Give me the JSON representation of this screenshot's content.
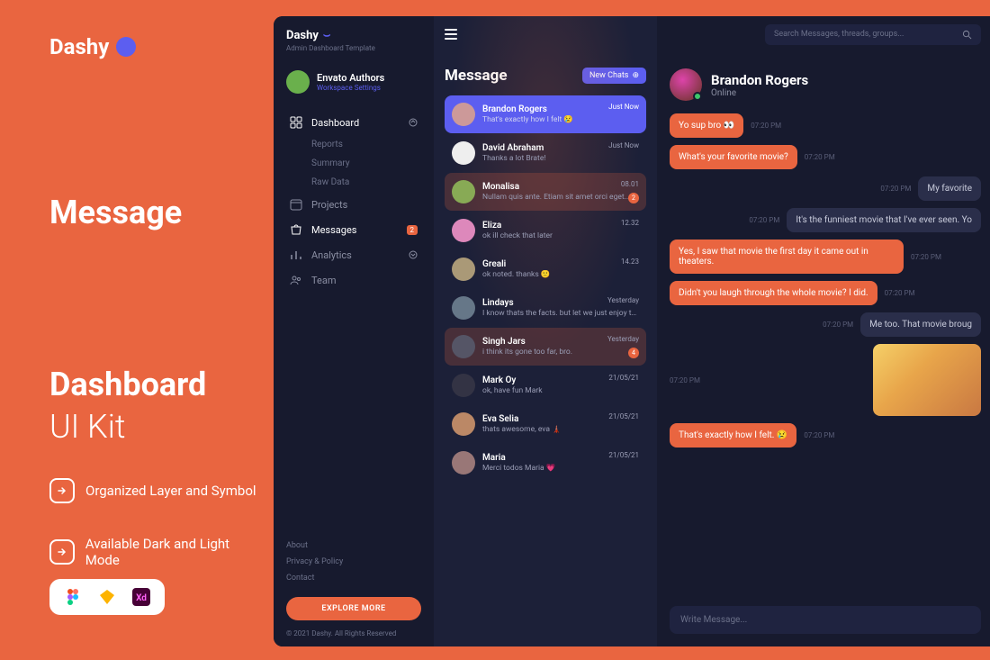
{
  "promo": {
    "brand": "Dashy",
    "title_l1": "Message",
    "title_l2": "Dashboard",
    "subtitle": "UI Kit",
    "feat1": "Organized Layer and Symbol",
    "feat2": "Available Dark and Light Mode"
  },
  "app": {
    "brand": "Dashy",
    "tagline": "Admin Dashboard Template",
    "workspace": {
      "name": "Envato Authors",
      "settings": "Workspace Settings"
    },
    "nav": {
      "dashboard": "Dashboard",
      "reports": "Reports",
      "summary": "Summary",
      "rawdata": "Raw Data",
      "projects": "Projects",
      "messages": "Messages",
      "messages_badge": "2",
      "analytics": "Analytics",
      "team": "Team"
    },
    "links": {
      "about": "About",
      "privacy": "Privacy & Policy",
      "contact": "Contact"
    },
    "cta": "EXPLORE MORE",
    "footer": "© 2021 Dashy. All Rights Reserved"
  },
  "search": {
    "placeholder": "Search Messages, threads, groups..."
  },
  "msglist": {
    "title": "Message",
    "new_label": "New Chats",
    "threads": [
      {
        "name": "Brandon Rogers",
        "preview": "That's exactly how I felt 😢",
        "time": "Just Now"
      },
      {
        "name": "David Abraham",
        "preview": "Thanks a lot Brate!",
        "time": "Just Now"
      },
      {
        "name": "Monalisa",
        "preview": "Nullam quis ante. Etiam sit amet orci eget...",
        "time": "08.01",
        "badge": "2"
      },
      {
        "name": "Eliza",
        "preview": "ok ill check that later",
        "time": "12.32"
      },
      {
        "name": "Greali",
        "preview": "ok noted. thanks 🙂",
        "time": "14.23"
      },
      {
        "name": "Lindays",
        "preview": "I know thats the facts. but let we just enjoy th...",
        "time": "Yesterday"
      },
      {
        "name": "Singh Jars",
        "preview": "i think its gone too far, bro.",
        "time": "Yesterday",
        "badge": "4"
      },
      {
        "name": "Mark Oy",
        "preview": "ok, have fun Mark",
        "time": "21/05/21"
      },
      {
        "name": "Eva Selia",
        "preview": "thats awesome, eva 🗼",
        "time": "21/05/21"
      },
      {
        "name": "Maria",
        "preview": "Merci todos Maria 💗",
        "time": "21/05/21"
      }
    ]
  },
  "chat": {
    "name": "Brandon Rogers",
    "status": "Online",
    "composer": "Write Message...",
    "m": [
      {
        "dir": "out",
        "text": "Yo sup bro 👀",
        "time": "07:20 PM"
      },
      {
        "dir": "out",
        "text": "What's your favorite movie?",
        "time": "07:20 PM"
      },
      {
        "dir": "in",
        "text": "My favorite",
        "time": "07:20 PM"
      },
      {
        "dir": "in",
        "text": "It's the funniest movie that I've ever seen. Yo",
        "time": "07:20 PM"
      },
      {
        "dir": "out",
        "text": "Yes, I saw that movie the first day it came out in theaters.",
        "time": "07:20 PM"
      },
      {
        "dir": "out",
        "text": "Didn't you laugh through the whole movie? I did.",
        "time": "07:20 PM"
      },
      {
        "dir": "in",
        "text": "Me too. That movie broug",
        "time": "07:20 PM"
      },
      {
        "dir": "in_img",
        "time": "07:20 PM"
      },
      {
        "dir": "out",
        "text": "That's exactly how I felt. 😢",
        "time": "07:20 PM"
      }
    ]
  }
}
